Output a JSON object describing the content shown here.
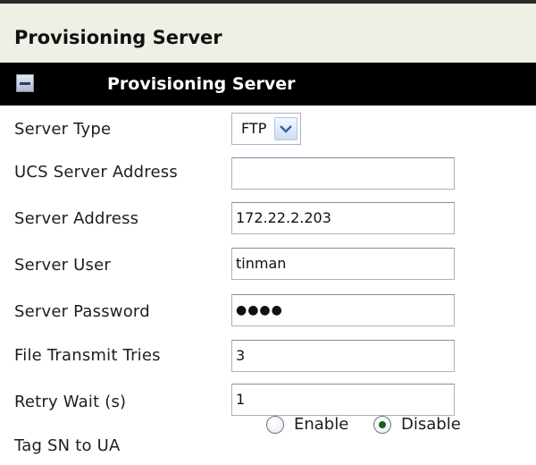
{
  "page": {
    "title": "Provisioning Server"
  },
  "section": {
    "title": "Provisioning Server",
    "collapse_icon": "minus-box-icon"
  },
  "fields": {
    "server_type": {
      "label": "Server Type",
      "value": "FTP",
      "arrow_icon": "chevron-down-icon"
    },
    "ucs_server_address": {
      "label": "UCS Server Address",
      "value": ""
    },
    "server_address": {
      "label": "Server Address",
      "value": "172.22.2.203"
    },
    "server_user": {
      "label": "Server User",
      "value": "tinman"
    },
    "server_password": {
      "label": "Server Password",
      "masked_value": "●●●●"
    },
    "file_transmit_tries": {
      "label": "File Transmit Tries",
      "value": "3"
    },
    "retry_wait": {
      "label": "Retry Wait (s)",
      "value": "1"
    },
    "tag_sn_to_ua": {
      "label": "Tag SN to UA",
      "options": [
        {
          "label": "Enable",
          "selected": false
        },
        {
          "label": "Disable",
          "selected": true
        }
      ]
    }
  }
}
